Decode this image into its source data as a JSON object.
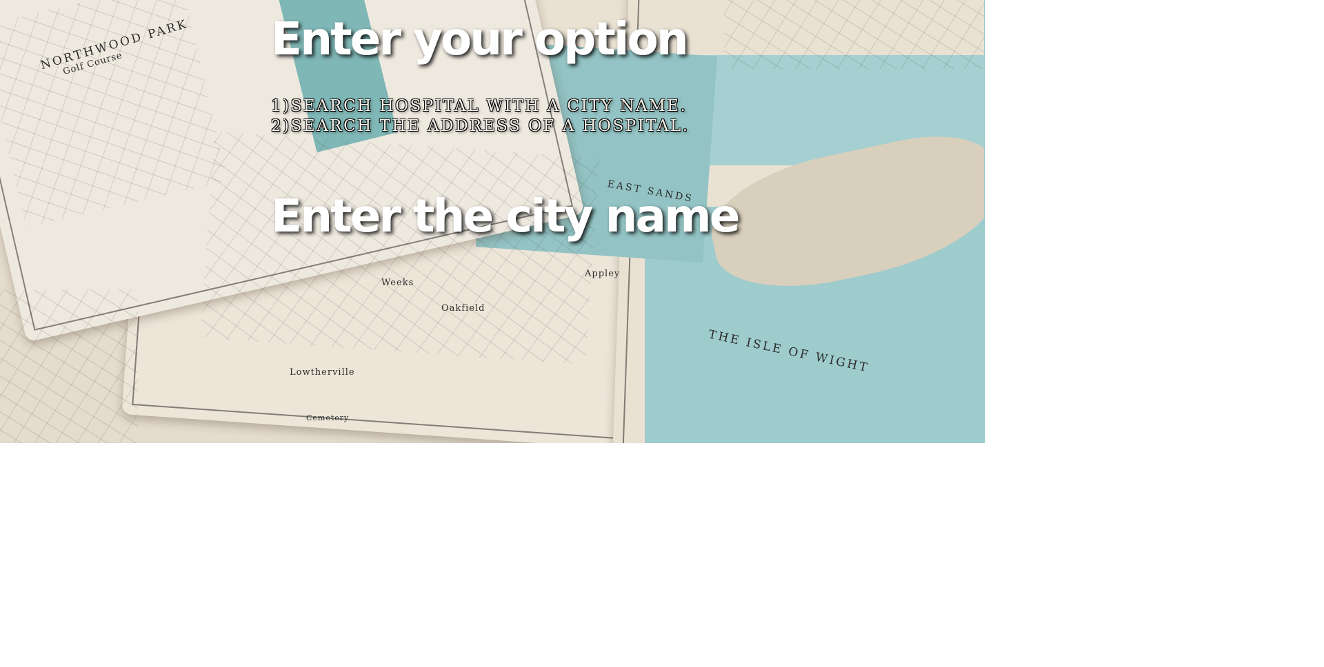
{
  "headings": {
    "option": "Enter your option",
    "city": "Enter the city name"
  },
  "options": [
    "1)SEARCH HOSPITAL WITH A CITY NAME.",
    "2)SEARCH THE ADDRESS OF A HOSPITAL."
  ],
  "background_map_labels": {
    "northwood": "NORTHWOOD PARK",
    "golf": "Golf Course",
    "east_sands": "EAST SANDS",
    "isle": "THE ISLE OF WIGHT",
    "lowtherville": "Lowtherville",
    "weeks": "Weeks",
    "oakfield": "Oakfield",
    "appley": "Appley",
    "cemetery": "Cemetery"
  },
  "colors": {
    "water": "#93c3c4",
    "paper": "#ece5d8",
    "heading": "#ffffff"
  }
}
